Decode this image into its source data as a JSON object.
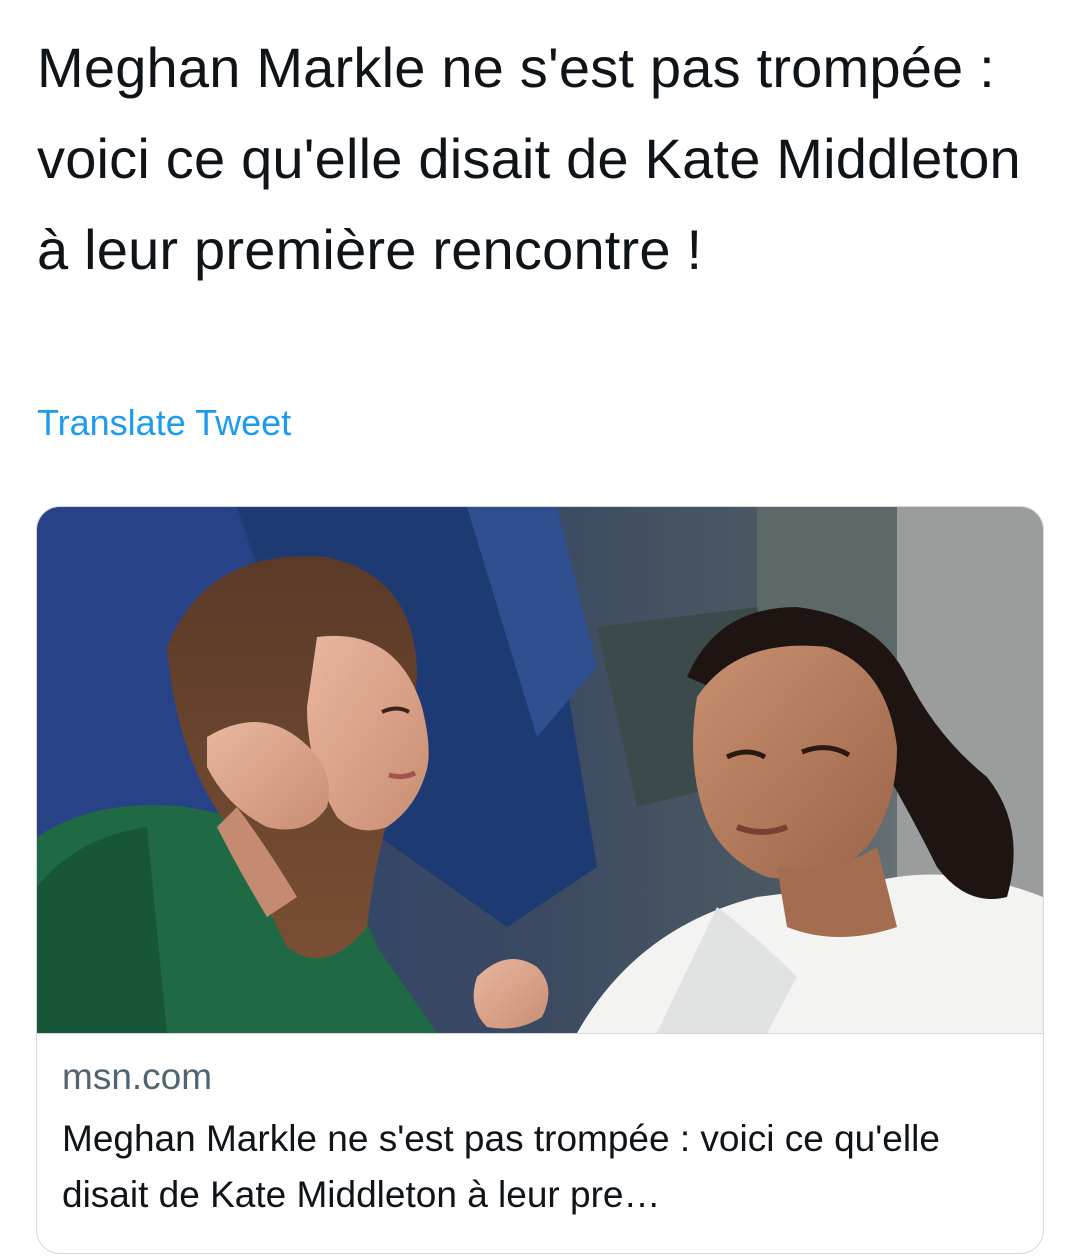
{
  "tweet": {
    "text": "Meghan Markle ne s'est pas trompée : voici ce qu'elle disait de Kate Middleton à leur première rencontre !",
    "translate_label": "Translate Tweet"
  },
  "card": {
    "domain": "msn.com",
    "title": "Meghan Markle ne s'est pas trompée : voici ce qu'elle disait de Kate Middleton à leur pre…",
    "image_alt": "Kate Middleton and Meghan Markle talking"
  },
  "colors": {
    "text": "#0f1419",
    "link": "#1d9bf0",
    "secondary": "#536471",
    "border": "#cfd9de"
  }
}
